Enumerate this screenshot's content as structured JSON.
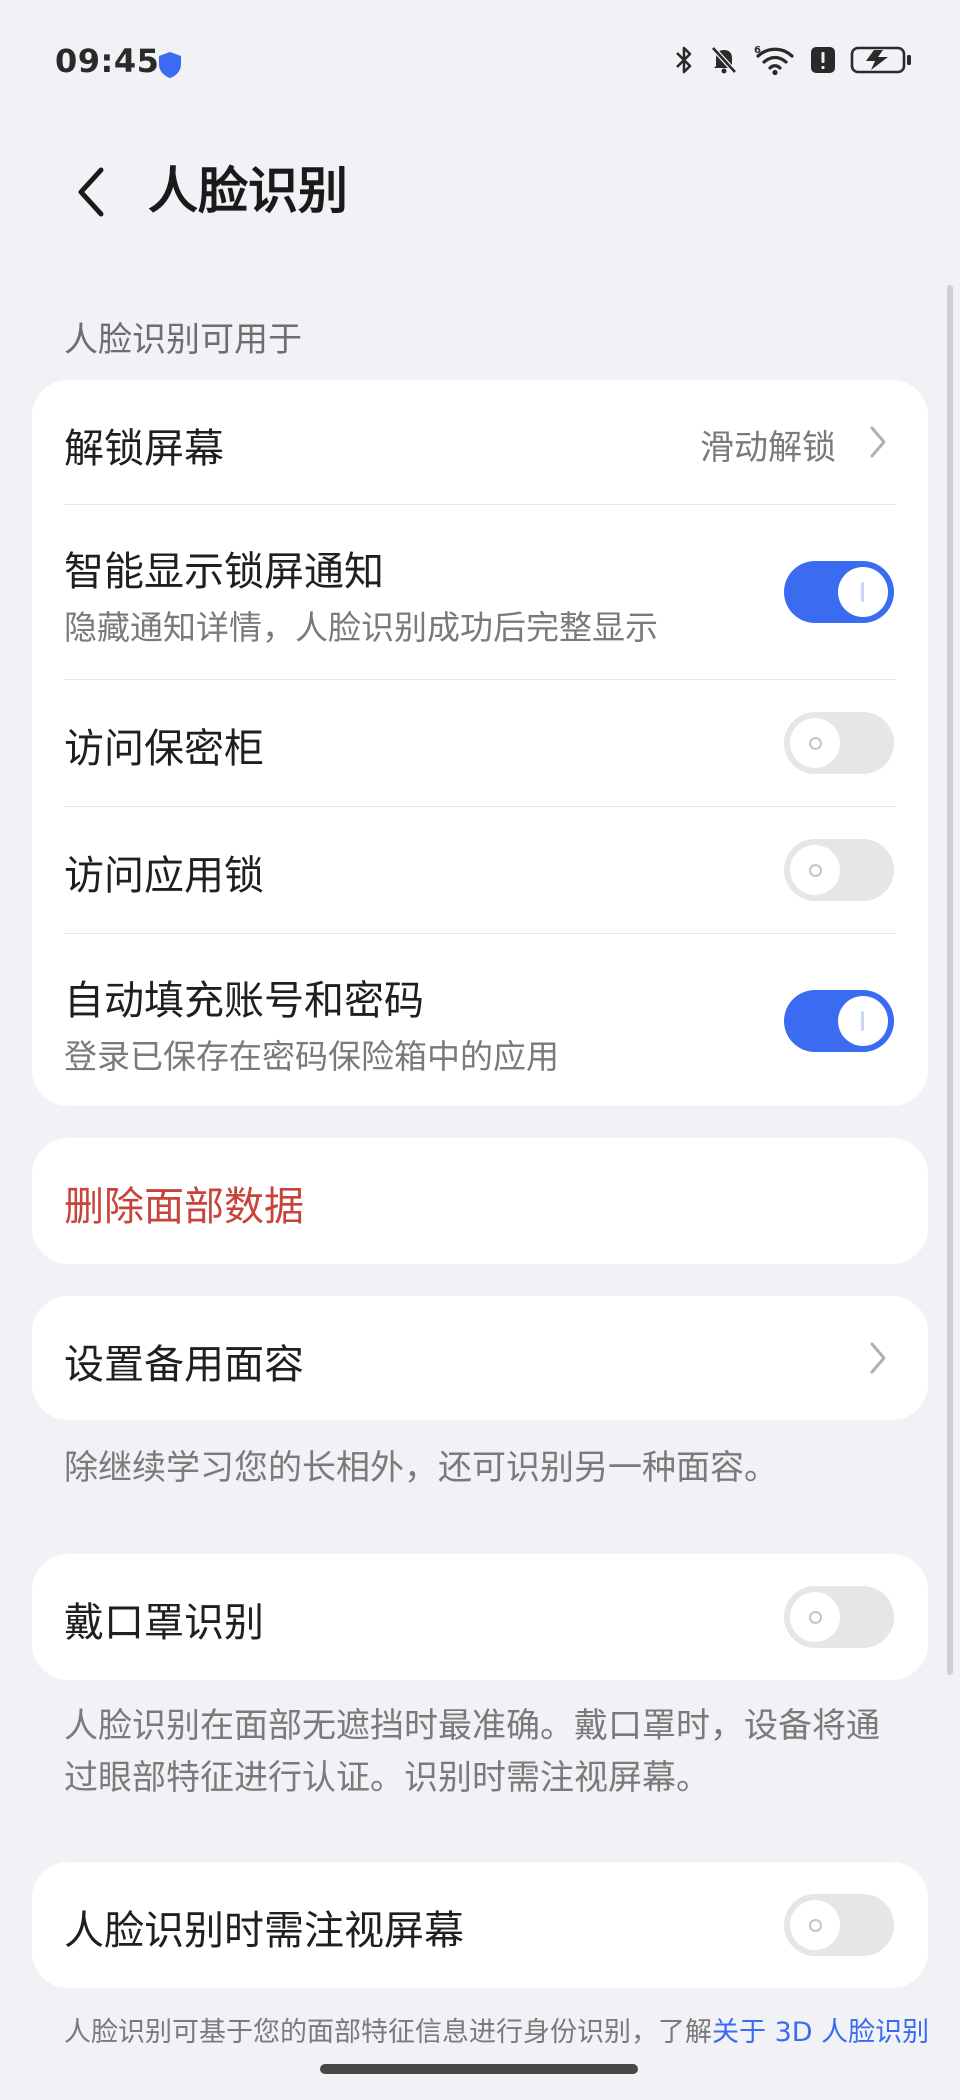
{
  "status_bar": {
    "time": "09:45",
    "icons": [
      "shield-icon",
      "bluetooth-icon",
      "mute-icon",
      "wifi-6-icon",
      "alert-icon",
      "battery-charging-icon"
    ],
    "accent": "#3A6BF0"
  },
  "header": {
    "back_icon": "chevron-left-icon",
    "title": "人脸识别"
  },
  "section_usage": {
    "label": "人脸识别可用于",
    "rows": [
      {
        "title": "解锁屏幕",
        "value": "滑动解锁",
        "control": "chevron"
      },
      {
        "title": "智能显示锁屏通知",
        "subtitle": "隐藏通知详情，人脸识别成功后完整显示",
        "toggle": "on"
      },
      {
        "title": "访问保密柜",
        "toggle": "off"
      },
      {
        "title": "访问应用锁",
        "toggle": "off"
      },
      {
        "title": "自动填充账号和密码",
        "subtitle": "登录已保存在密码保险箱中的应用",
        "toggle": "on"
      }
    ]
  },
  "delete_card": {
    "label": "删除面部数据",
    "color": "#C8443A"
  },
  "alternate_card": {
    "title": "设置备用面容",
    "hint": "除继续学习您的长相外，还可识别另一种面容。"
  },
  "mask_card": {
    "title": "戴口罩识别",
    "toggle": "off",
    "hint": "人脸识别在面部无遮挡时最准确。戴口罩时，设备将通过眼部特征进行认证。识别时需注视屏幕。"
  },
  "attention_card": {
    "title": "人脸识别时需注视屏幕",
    "toggle": "off"
  },
  "footer": {
    "text": "人脸识别可基于您的面部特征信息进行身份识别，了解",
    "link": "关于 3D 人脸识别"
  }
}
